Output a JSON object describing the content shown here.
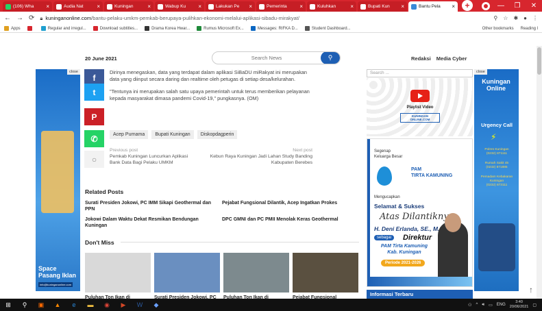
{
  "browser": {
    "tabs": [
      {
        "label": "(106) Wha",
        "color": "#25d366"
      },
      {
        "label": "Audia Nat",
        "color": "#ffffff"
      },
      {
        "label": "Kuningan",
        "color": "#ffffff"
      },
      {
        "label": "Wabup Ku",
        "color": "#ffffff"
      },
      {
        "label": "Lakukan Pe",
        "color": "#ffffff"
      },
      {
        "label": "Pemerinta",
        "color": "#ffffff"
      },
      {
        "label": "Kuluhkan",
        "color": "#ffffff"
      },
      {
        "label": "Bupati Kun",
        "color": "#ffffff"
      },
      {
        "label": "Bantu Pela",
        "color": "#3a8ad8"
      }
    ],
    "url_domain": "kuninganonline.com",
    "url_path": "/bantu-pelaku-umkm-pemkab-berupaya-pulihkan-ekonomi-melalui-aplikasi-sibadu-mirakyat/",
    "bookmarks": [
      {
        "label": "Apps",
        "color": "#e0a020"
      },
      {
        "label": "",
        "color": "#d7262e"
      },
      {
        "label": "Regular and irregul...",
        "color": "#20a0d0"
      },
      {
        "label": "Download subtitles...",
        "color": "#d7262e"
      },
      {
        "label": "Drama Korea Hwar...",
        "color": "#333333"
      },
      {
        "label": "Rumus Microsoft Ex...",
        "color": "#1f8a3a"
      },
      {
        "label": "Messages: RIFKA D...",
        "color": "#0a66c2"
      },
      {
        "label": "Student Dashboard...",
        "color": "#555555"
      }
    ],
    "bookmarks_right": [
      "Other bookmarks",
      "Reading l"
    ]
  },
  "site": {
    "date": "20 June 2021",
    "search_placeholder": "Search News",
    "top_links": [
      "Redaksi",
      "Media Cyber"
    ]
  },
  "ad_left": {
    "close": "close",
    "tagline": "Space\nPasang Iklan",
    "email": "info@kuninganonline.com"
  },
  "article": {
    "paragraphs": [
      "Dirinya menegaskan, data yang terdapat dalam aplikasi SiBaDU miRakyat ini merupakan data yang diinput secara daring dan realtime oleh petugas di setiap desa/kelurahan.",
      "\"Tentunya ini merupakan salah satu upaya pemerintah untuk terus memberikan pelayanan kepada masyarakat dimasa pandemi Covid-19,\" pungkasnya. (OM)"
    ],
    "tags": [
      "Acep Purnama",
      "Bupati Kuningan",
      "Diskopdagperin"
    ],
    "prev_label": "Previous post",
    "prev_title": "Pemkab Kuningan Luncurkan Aplikasi Bank Data Bagi Pelaku UMKM",
    "next_label": "Next post",
    "next_title": "Kebun Raya Kuningan Jadi Lahan Study Banding Kabupaten Berebes"
  },
  "share_icons": [
    {
      "name": "facebook-icon",
      "glyph": "f",
      "color": "#3b5998"
    },
    {
      "name": "twitter-icon",
      "glyph": "t",
      "color": "#1da1f2"
    },
    {
      "name": "pinterest-icon",
      "glyph": "P",
      "color": "#cb2027"
    },
    {
      "name": "whatsapp-icon",
      "glyph": "✆",
      "color": "#25d366"
    },
    {
      "name": "comment-icon",
      "glyph": "○",
      "color": "#888888"
    }
  ],
  "related": {
    "heading": "Related Posts",
    "items": [
      "Surati Presiden Jokowi, PC IMM Sikapi Geothermal dan PPN",
      "Pejabat Fungsional Dilantik, Acep Ingatkan Prokes",
      "Jokowi Dalam Waktu Dekat Resmikan Bendungan Kuningan",
      "DPC GMNI dan PC PMII Menolak Keras Geothermal"
    ]
  },
  "dont_miss": {
    "heading": "Don't Miss",
    "items": [
      {
        "caption": "Puluhan Ton Ikan di",
        "color": "#d9d9d9"
      },
      {
        "caption": "Surati Presiden Jokowi, PC",
        "color": "#6a8fc0"
      },
      {
        "caption": "Puluhan Ton Ikan di",
        "color": "#7d8a8e"
      },
      {
        "caption": "Pejabat Fungsional",
        "color": "#5a5040"
      }
    ]
  },
  "sidebar": {
    "search_placeholder": "Search ...",
    "playlist_label": "Playlist Video",
    "kuningan_logo": "KUNINGAN ONLINE.COM",
    "pam": {
      "greeting": "Segenap\nKeluarga Besar",
      "name": "PAM\nTIRTA KAMUNING",
      "ucapan": "Mengucapkan",
      "selamat": "Selamat & Sukses",
      "atas": "Atas Dilantiknya",
      "person": "H. Deni Erlanda, SE., M.Si",
      "sebagai": "sebagai",
      "jabatan": "Direktur",
      "instansi": "PAM Tirta Kamuning\nKab. Kuningan",
      "periode": "Periode 2021-2026"
    },
    "info_terbaru": "Informasi Terbaru"
  },
  "ad_right": {
    "close": "close",
    "title": "Kuningan\nOnline",
    "urgency": "Urgency Call",
    "contacts": [
      "Polres Kuningan\n(0232) 871111",
      "Rumah Sakit 45\n(0232) 871885",
      "Pemadam Kebakaran\nKuningan\n(0232) 873111"
    ]
  },
  "taskbar": {
    "lang": "ENG",
    "time": "3:40",
    "date": "20/06/2021"
  }
}
